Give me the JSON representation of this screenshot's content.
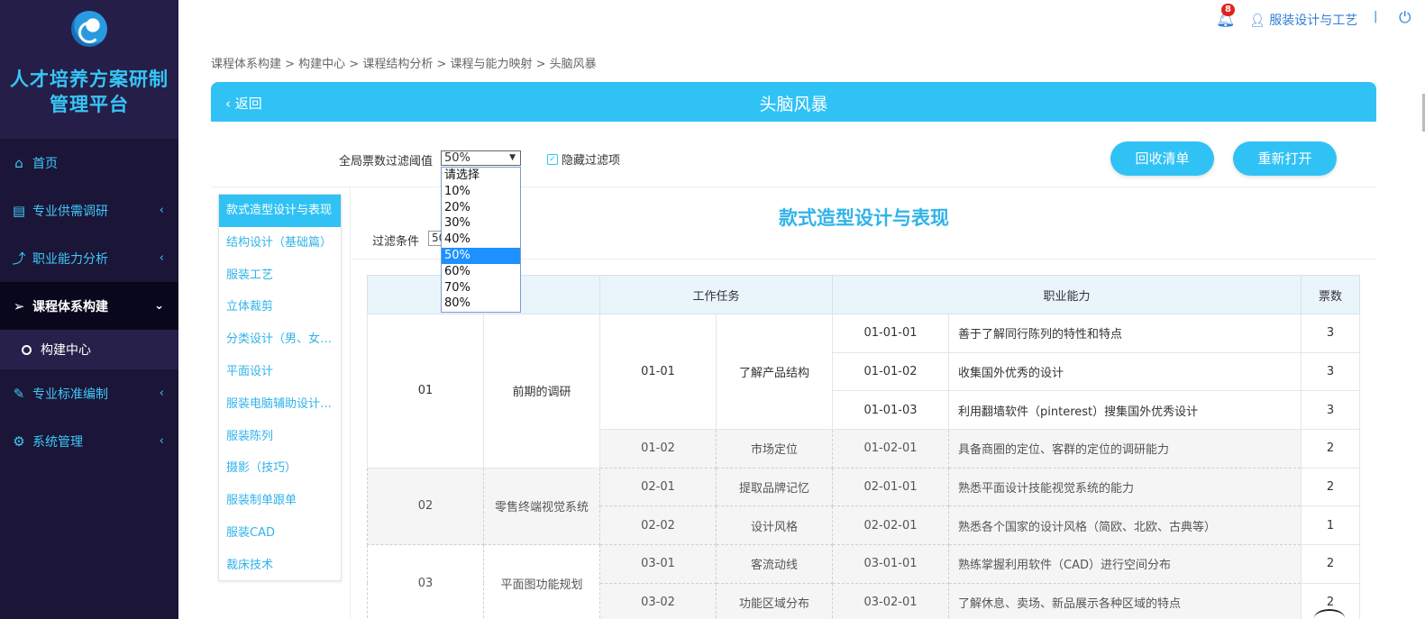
{
  "sidebar": {
    "brand_line1": "人才培养方案研制",
    "brand_line2": "管理平台",
    "items": [
      {
        "icon": "home-icon",
        "label": "首页"
      },
      {
        "icon": "clipboard-icon",
        "label": "专业供需调研"
      },
      {
        "icon": "trend-icon",
        "label": "职业能力分析"
      },
      {
        "icon": "send-icon",
        "label": "课程体系构建"
      },
      {
        "icon": "edit-icon",
        "label": "专业标准编制"
      },
      {
        "icon": "gear-icon",
        "label": "系统管理"
      }
    ],
    "sub_item": "构建中心"
  },
  "topbar": {
    "notification_count": "8",
    "username": "服装设计与工艺"
  },
  "breadcrumb": "课程体系构建 > 构建中心 > 课程结构分析 > 课程与能力映射 > 头脑风暴",
  "header": {
    "back_label": "返回",
    "title": "头脑风暴"
  },
  "filter": {
    "label": "全局票数过滤阈值",
    "selected": "50%",
    "options": [
      "请选择",
      "10%",
      "20%",
      "30%",
      "40%",
      "50%",
      "60%",
      "70%",
      "80%"
    ],
    "hide_label": "隐藏过滤项"
  },
  "buttons": {
    "recycle": "回收清单",
    "reopen": "重新打开"
  },
  "courses": [
    "款式造型设计与表现",
    "结构设计（基础篇）",
    "服装工艺",
    "立体裁剪",
    "分类设计（男、女装…",
    "平面设计",
    "服装电脑辅助设计（…",
    "服装陈列",
    "摄影（技巧）",
    "服装制单跟单",
    "服装CAD",
    "裁床技术"
  ],
  "course_title": "款式造型设计与表现",
  "condition": {
    "label": "过滤条件",
    "value": "50"
  },
  "table": {
    "headers": {
      "task": "工作任务",
      "ability": "职业能力",
      "votes": "票数"
    },
    "rows": [
      {
        "g": "01",
        "gname": "前期的调研",
        "t": "01-01",
        "tname": "了解产品结构",
        "a": "01-01-01",
        "aname": "善于了解同行陈列的特性和特点",
        "v": "3"
      },
      {
        "g": "",
        "gname": "",
        "t": "",
        "tname": "",
        "a": "01-01-02",
        "aname": "收集国外优秀的设计",
        "v": "3"
      },
      {
        "g": "",
        "gname": "",
        "t": "",
        "tname": "",
        "a": "01-01-03",
        "aname": "利用翻墙软件（pinterest）搜集国外优秀设计",
        "v": "3"
      },
      {
        "g": "",
        "gname": "",
        "t": "01-02",
        "tname": "市场定位",
        "a": "01-02-01",
        "aname": "具备商圈的定位、客群的定位的调研能力",
        "v": "2"
      },
      {
        "g": "02",
        "gname": "零售终端视觉系统",
        "t": "02-01",
        "tname": "提取品牌记忆",
        "a": "02-01-01",
        "aname": "熟悉平面设计技能视觉系统的能力",
        "v": "2"
      },
      {
        "g": "",
        "gname": "",
        "t": "02-02",
        "tname": "设计风格",
        "a": "02-02-01",
        "aname": "熟悉各个国家的设计风格（简欧、北欧、古典等）",
        "v": "1"
      },
      {
        "g": "03",
        "gname": "平面图功能规划",
        "t": "03-01",
        "tname": "客流动线",
        "a": "03-01-01",
        "aname": "熟练掌握利用软件（CAD）进行空间分布",
        "v": "2"
      },
      {
        "g": "",
        "gname": "",
        "t": "03-02",
        "tname": "功能区域分布",
        "a": "03-02-01",
        "aname": "了解休息、卖场、新品展示各种区域的特点",
        "v": "2"
      }
    ]
  }
}
